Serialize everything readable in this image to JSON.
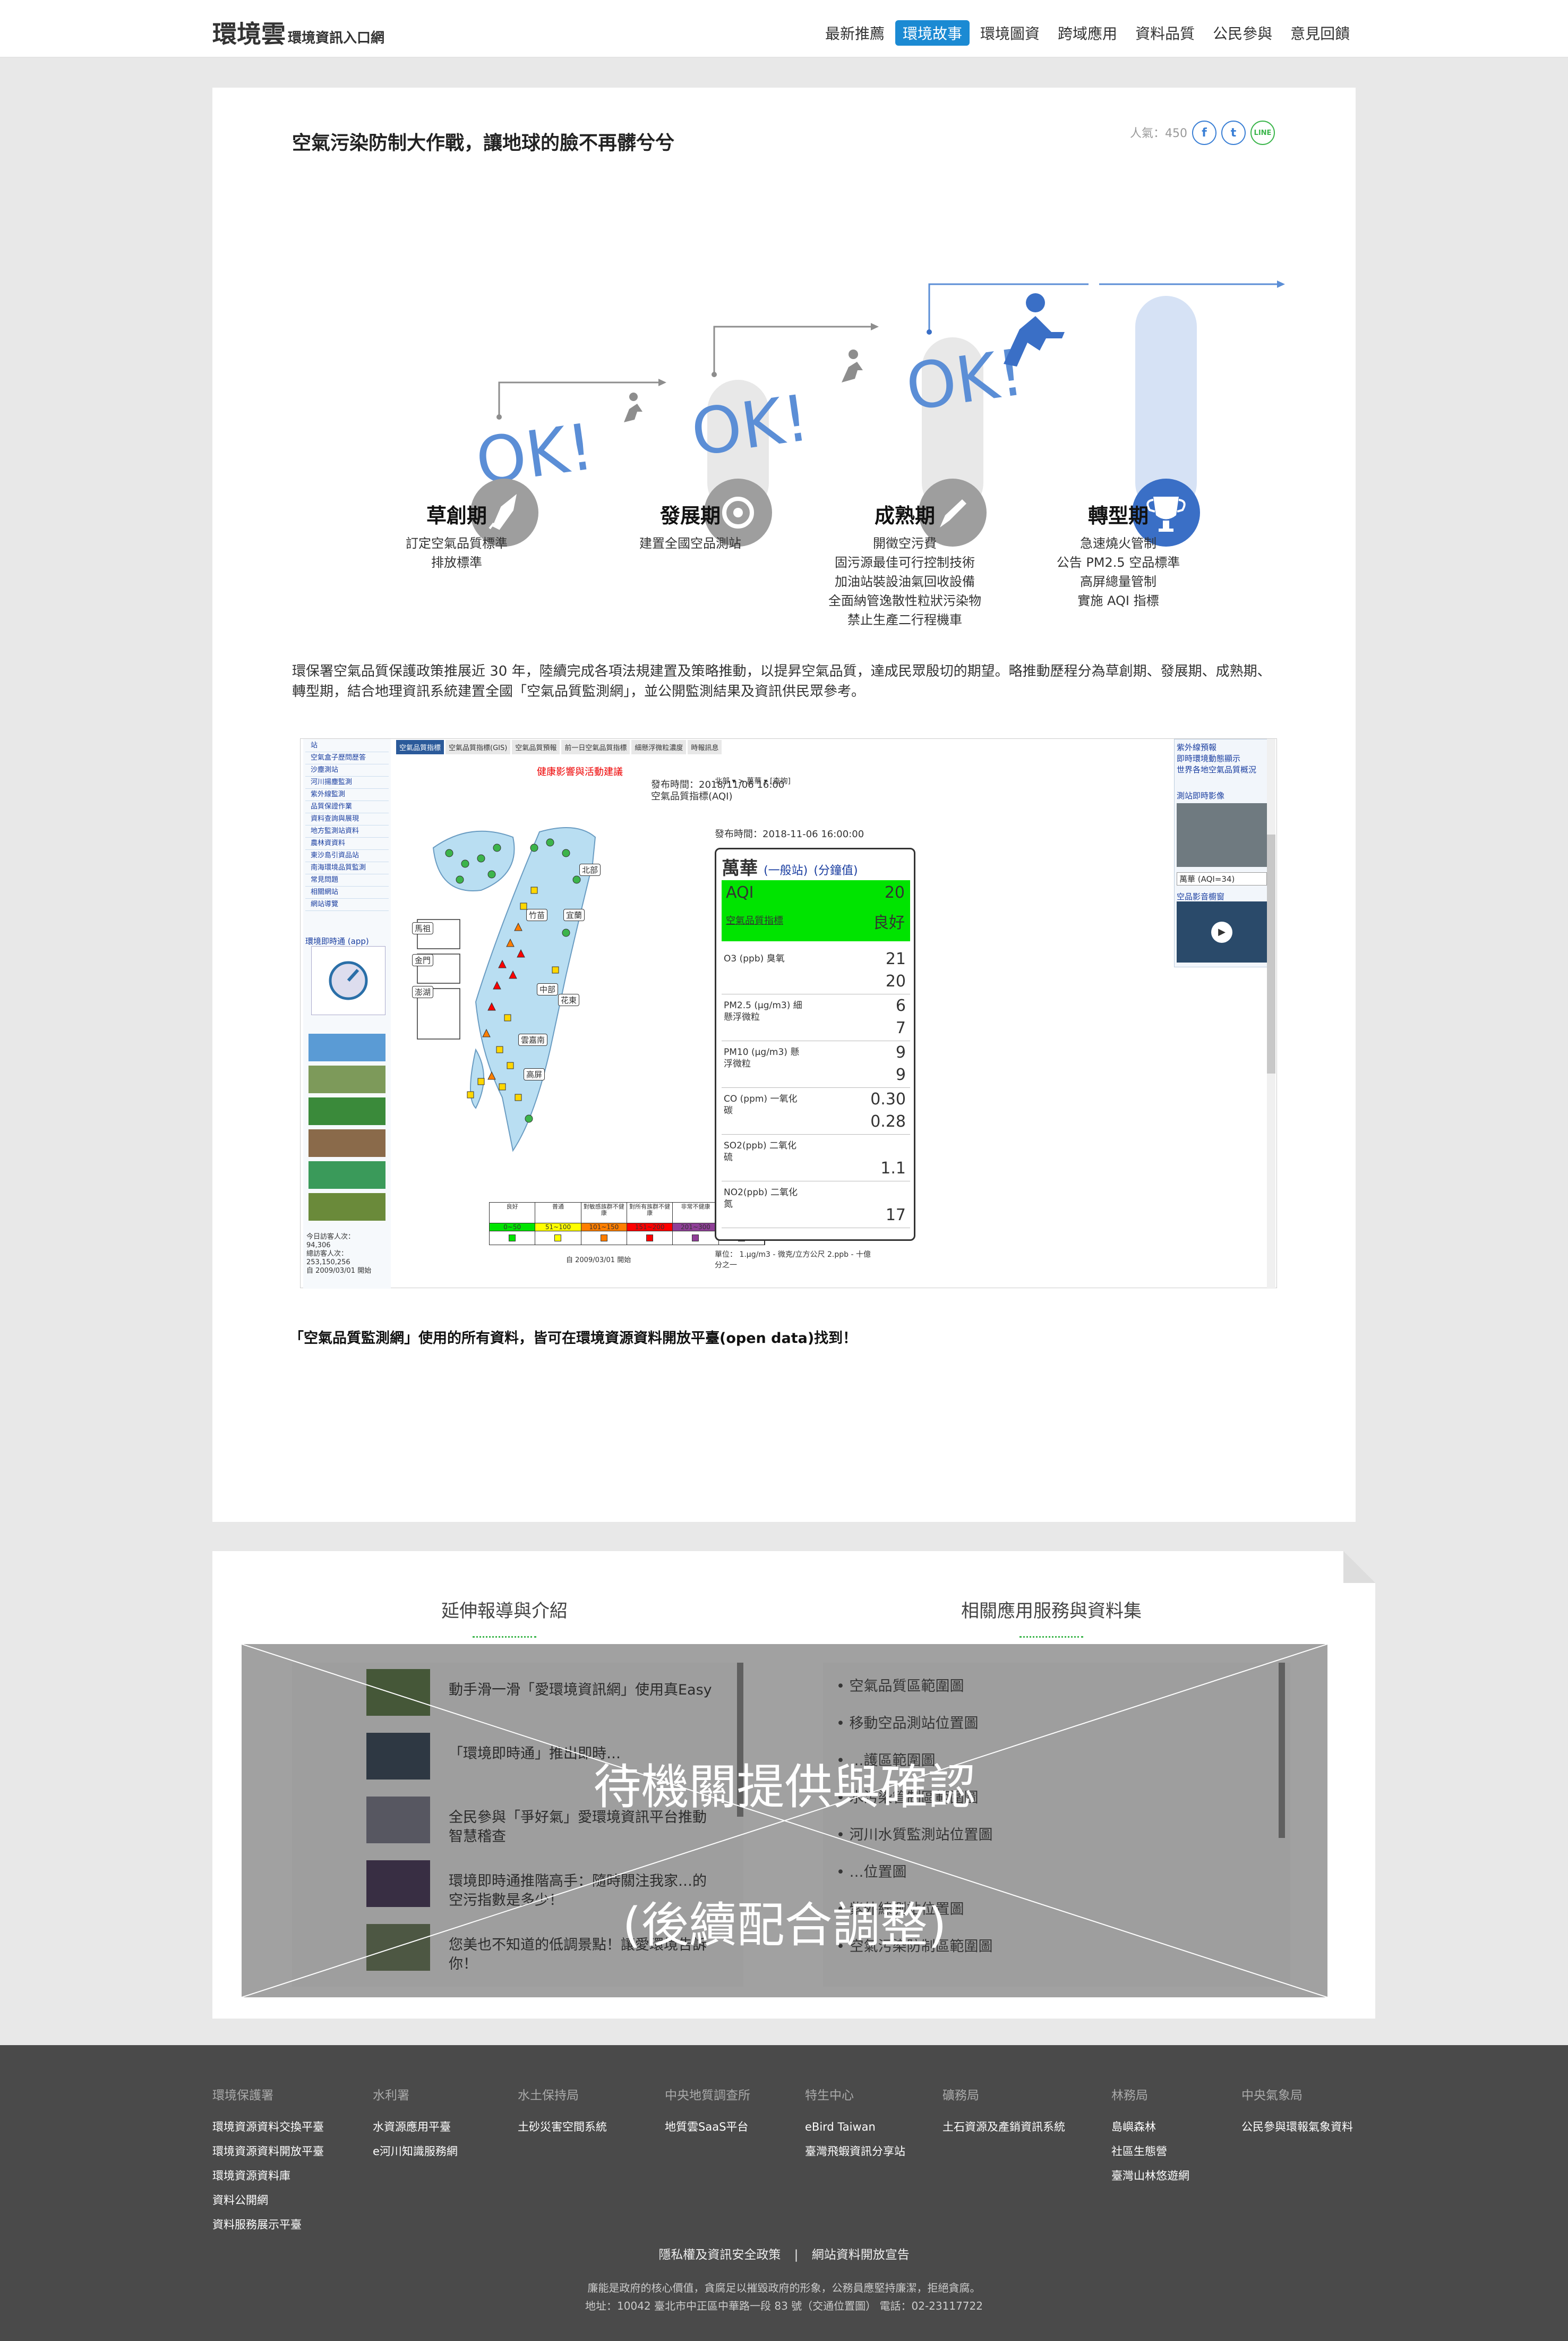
{
  "header": {
    "logo_main": "環境雲",
    "logo_sub": "環境資訊入口網",
    "nav": [
      "最新推薦",
      "環境故事",
      "環境圖資",
      "跨域應用",
      "資料品質",
      "公民參與",
      "意見回饋"
    ],
    "active_nav": "環境故事"
  },
  "article": {
    "title": "空氣污染防制大作戰，讓地球的臉不再髒兮兮",
    "popularity": "人氣：450",
    "ok_label": "OK!",
    "phases": [
      {
        "title": "草創期",
        "items": [
          "訂定空氣品質標準",
          "排放標準"
        ]
      },
      {
        "title": "發展期",
        "items": [
          "建置全國空品測站"
        ]
      },
      {
        "title": "成熟期",
        "items": [
          "開徵空污費",
          "固污源最佳可行控制技術",
          "加油站裝設油氣回收設備",
          "全面納管逸散性粒狀污染物",
          "禁止生產二行程機車"
        ]
      },
      {
        "title": "轉型期",
        "items": [
          "急速燒火管制",
          "公告 PM2.5 空品標準",
          "高屏總量管制",
          "實施 AQI 指標"
        ]
      }
    ],
    "intro": "環保署空氣品質保護政策推展近 30 年，陸續完成各項法規建置及策略推動，以提昇空氣品質，達成民眾殷切的期望。略推動歷程分為草創期、發展期、成熟期、轉型期，結合地理資訊系統建置全國「空氣品質監測網」，並公開監測結果及資訊供民眾參考。",
    "footnote": "「空氣品質監測網」使用的所有資料，皆可在環境資源資料開放平臺(open data)找到！"
  },
  "map_screenshot": {
    "warning": "健康影響與活動建議",
    "publish": "發布時間：2018/11/06 16:00",
    "index_name": "空氣品質指標(AQI)",
    "station": "萬華",
    "station_links": "(一般站)",
    "minute_link": "(分鐘值)",
    "publish2": "發布時間：2018-11-06 16:00:00",
    "aqi_label": "AQI",
    "aqi_value": "20",
    "aqi_sub": "空氣品質指標",
    "aqi_status": "良好",
    "pollutants": [
      {
        "name": "O3 (ppb) 臭氧",
        "v1": "21",
        "v2": "20"
      },
      {
        "name": "PM2.5 (μg/m3) 細懸浮微粒",
        "v1": "6",
        "v2": "7"
      },
      {
        "name": "PM10 (μg/m3) 懸浮微粒",
        "v1": "9",
        "v2": "9"
      },
      {
        "name": "CO (ppm) 一氧化碳",
        "v1": "0.30",
        "v2": "0.28"
      },
      {
        "name": "SO2(ppb) 二氧化硫",
        "v1": "",
        "v2": "1.1"
      },
      {
        "name": "NO2(ppb) 二氧化氮",
        "v1": "",
        "v2": "17"
      }
    ],
    "regions": [
      "北部",
      "竹苗",
      "宜蘭",
      "中部",
      "花東",
      "雲嘉南",
      "高屏",
      "馬祖",
      "金門",
      "澎湖"
    ],
    "legend": [
      {
        "label": "良好",
        "range": "0~50",
        "color": "#00e400"
      },
      {
        "label": "普通",
        "range": "51~100",
        "color": "#ffff00"
      },
      {
        "label": "對敏感族群不健康",
        "range": "101~150",
        "color": "#ff7e00"
      },
      {
        "label": "對所有族群不健康",
        "range": "151~200",
        "color": "#ff0000"
      },
      {
        "label": "非常不健康",
        "range": "201~300",
        "color": "#8f3f97"
      },
      {
        "label": "危害",
        "range": "301~500",
        "color": "#7e0023"
      }
    ],
    "tabs": [
      "空氣品質指標",
      "空氣品質指標(GIS)",
      "空氣品質預報",
      "前一日空氣品質指標",
      "細懸浮微粒濃度",
      "時報訊息"
    ],
    "left_menu": [
      "站",
      "空氣盒子歷問歷答",
      "沙塵測站",
      "河川揚塵監測",
      "紫外線監測",
      "品質保證作業",
      "資料查詢與展現",
      "地方監測站資料",
      "農林資資料",
      "東沙島引資品站",
      "南海環境品質監測",
      "常見問題",
      "相關網站",
      "網站導覽"
    ],
    "app_label": "環境即時通 (app)",
    "visitor_today": "今日訪客人次：",
    "visitor_count": "94,306",
    "visitor_total": "總訪客人次：",
    "visitor_total_count": "253,150,256",
    "since": "自 2009/03/01 開始",
    "unit_note": "單位： 1.μg/m3 - 微克/立方公尺 2.ppb - 十億分之一",
    "right_links": [
      "紫外線預報",
      "即時環境動態顯示",
      "世界各地空氣品質概況"
    ],
    "cam_label": "測站即時影像",
    "cam_station": "萬華 (AQI=34)",
    "video_label": "空品影音櫥窗"
  },
  "related": {
    "left_heading": "延伸報導與介紹",
    "right_heading": "相關應用服務與資料集",
    "left_items": [
      "動手滑一滑「愛環境資訊網」使用真Easy",
      "「環境即時通」推出即時…",
      "全民參與「爭好氣」愛環境資訊平台推動智慧稽查",
      "環境即時通推階高手：隨時關注我家…的空污指數是多少！",
      "您美也不知道的低調景點！讓愛環境告訴你！"
    ],
    "right_items": [
      "空氣品質區範圍圖",
      "移動空品測站位置圖",
      "…護區範圍圖",
      "水污染管制區範圍圖",
      "河川水質監測站位置圖",
      "…位置圖",
      "紫外線測站位置圖",
      "空氣污染防制區範圍圖"
    ],
    "overlay_line1": "待機關提供與確認",
    "overlay_line2": "(後續配合調整)"
  },
  "footer": {
    "columns": [
      {
        "head": "環境保護署",
        "links": [
          "環境資源資料交換平臺",
          "環境資源資料開放平臺",
          "環境資源資料庫",
          "資料公開網",
          "資料服務展示平臺"
        ]
      },
      {
        "head": "水利署",
        "links": [
          "水資源應用平臺",
          "e河川知識服務網"
        ]
      },
      {
        "head": "水土保持局",
        "links": [
          "土砂災害空間系統"
        ]
      },
      {
        "head": "中央地質調查所",
        "links": [
          "地質雲SaaS平台"
        ]
      },
      {
        "head": "特生中心",
        "links": [
          "eBird Taiwan",
          "臺灣飛蝦資訊分享站"
        ]
      },
      {
        "head": "礦務局",
        "links": [
          "土石資源及產銷資訊系統"
        ]
      },
      {
        "head": "林務局",
        "links": [
          "島嶼森林",
          "社區生態營",
          "臺灣山林悠遊網"
        ]
      },
      {
        "head": "中央氣象局",
        "links": [
          "公民參與環報氣象資料"
        ]
      }
    ],
    "privacy": "隱私權及資訊安全政策",
    "separator": "|",
    "open_data": "網站資料開放宣告",
    "motto": "廉能是政府的核心價值，貪腐足以摧毀政府的形象，公務員應堅持廉潔，拒絕貪腐。",
    "address": "地址：10042 臺北市中正區中華路一段 83 號（交通位置圖） 電話：02-23117722"
  }
}
